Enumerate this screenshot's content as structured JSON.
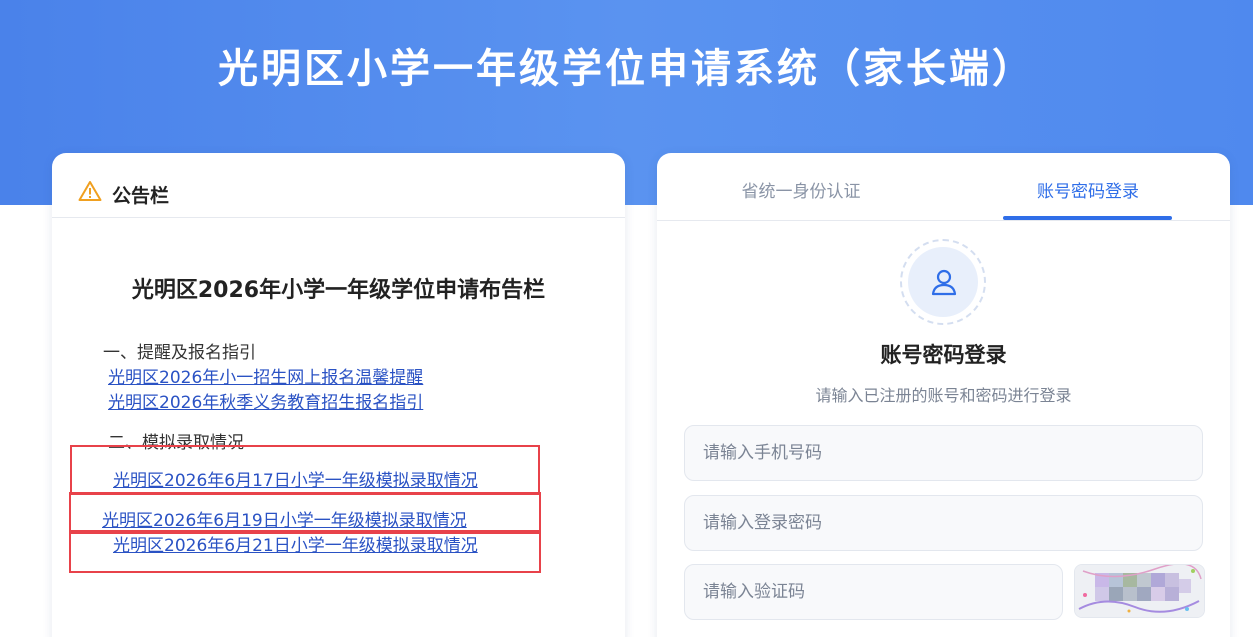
{
  "header": {
    "title": "光明区小学一年级学位申请系统（家长端）"
  },
  "notice": {
    "panel_title": "公告栏",
    "heading": "光明区2026年小学一年级学位申请布告栏",
    "section1_title": "一、提醒及报名指引",
    "section1_links": [
      "光明区2026年小一招生网上报名温馨提醒",
      "光明区2026年秋季义务教育招生报名指引"
    ],
    "section2_title": "二、模拟录取情况",
    "section2_links": [
      "光明区2026年6月17日小学一年级模拟录取情况",
      "光明区2026年6月19日小学一年级模拟录取情况",
      "光明区2026年6月21日小学一年级模拟录取情况"
    ]
  },
  "login": {
    "tabs": [
      "省统一身份认证",
      "账号密码登录"
    ],
    "active_tab": "账号密码登录",
    "title": "账号密码登录",
    "subtitle": "请输入已注册的账号和密码进行登录",
    "phone_placeholder": "请输入手机号码",
    "password_placeholder": "请输入登录密码",
    "captcha_placeholder": "请输入验证码"
  },
  "colors": {
    "header_blue": "#4f89ee",
    "accent_blue": "#2f6ee8",
    "link_blue": "#2a52c4",
    "warning_orange": "#f0a020",
    "highlight_red": "#e8424a"
  },
  "icons": {
    "notice": "warning-triangle-icon",
    "avatar": "user-icon"
  }
}
